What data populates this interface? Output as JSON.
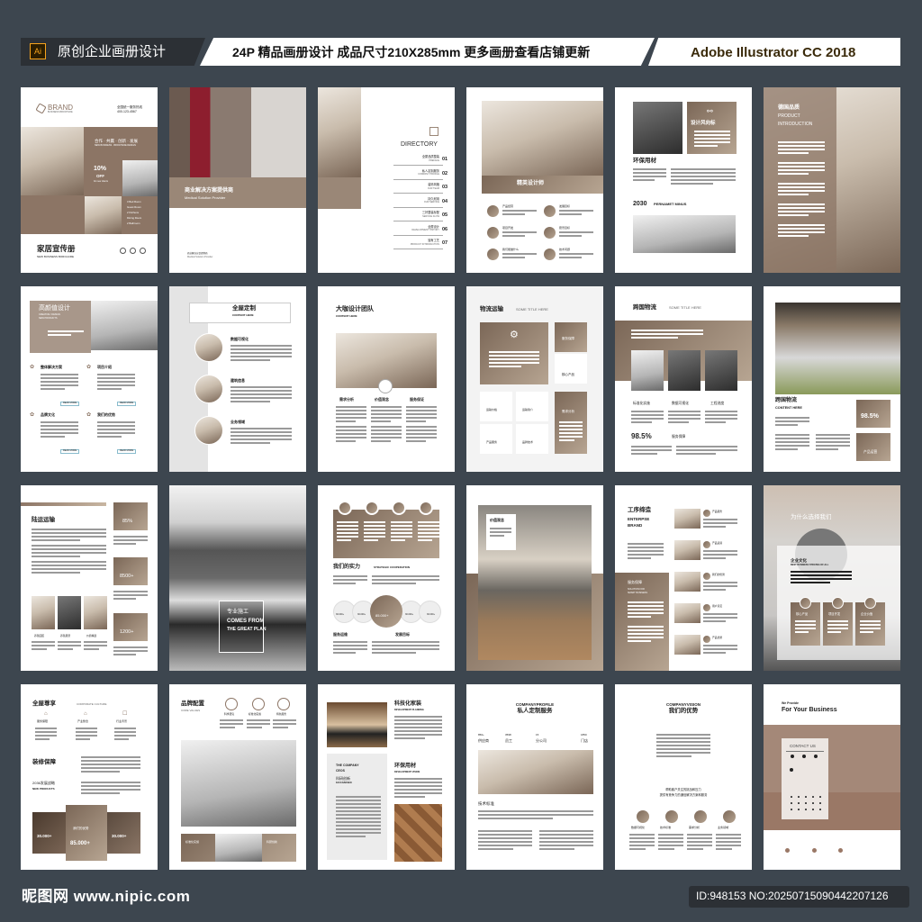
{
  "header": {
    "ai_badge": "Ai",
    "left_title": "原创企业画册设计",
    "center_text": "24P 精品画册设计 成品尺寸210X285mm 更多画册查看店铺更新",
    "right_text": "Adobe Illustrator CC 2018"
  },
  "footer": {
    "logo_text": "昵图网 www.nipic.com",
    "id_text": "ID:948153 NO:20250715090442207126"
  },
  "colors": {
    "background": "#3d464f",
    "accent_brown": "#8c7565",
    "tan_light": "#b7a592"
  },
  "pages": {
    "p1": {
      "brand": "BRAND",
      "brand_sub": "BUSINESS BROCHURE",
      "hotline": "全国统一服务热线",
      "phone": "400-123-4567",
      "slogan": "合作 · 共赢 · 创新 · 发展",
      "slogan_en": "NEW BUSINESS · BROCHURE DESIGN",
      "discount": "10%",
      "off": "OFF",
      "discount_note": "for new clients",
      "rooms": [
        "3 Bed Room",
        "Guest Room",
        "2 Kitchens",
        "Dining Room",
        "2 Bathroom"
      ],
      "title": "家居宣传册",
      "subtitle": "NEW BUSINESS BORCHURE"
    },
    "p2": {
      "title": "商业解决方案提供商",
      "subtitle": "Medical Solution Provider"
    },
    "p3": {
      "title": "DIRECTORY",
      "entries": [
        {
          "cn": "全屋品质整装",
          "en": "PREFACE",
          "num": "01"
        },
        {
          "cn": "私人定制服务",
          "en": "COMPANY PROFILE",
          "num": "02"
        },
        {
          "cn": "装饰风格",
          "en": "OUR TEAM",
          "num": "03"
        },
        {
          "cn": "持久耐用",
          "en": "OUR SERVICE",
          "num": "04"
        },
        {
          "cn": "三好整装标配",
          "en": "SERVICE FLOW",
          "num": "05"
        },
        {
          "cn": "全屋设计",
          "en": "DEVELOPMENT HISTORY",
          "num": "06"
        },
        {
          "cn": "独有工艺",
          "en": "PRODUCT INTRODUCTION",
          "num": "07"
        }
      ]
    },
    "p4": {
      "banner": "精英设计师",
      "items": [
        "产品经营",
        "发展目标",
        "项目开发",
        "愿景目标",
        "我们能做什么",
        "技术问题"
      ]
    },
    "p5": {
      "box_title": "设计风向标",
      "heading": "环保用材",
      "year_title": "2030",
      "year_sub": "PERNAMET MINUS"
    },
    "p6": {
      "title": "德国品质",
      "subtitle_1": "PRODUCT",
      "subtitle_2": "INTRODUCTION"
    },
    "p7": {
      "title": "高颜值设计",
      "sub1": "CREATIVE / DESIGN",
      "sub2": "NEW PRODUCTS",
      "items": [
        "整体解决方案",
        "项目介绍",
        "品牌文化",
        "我们的优势"
      ],
      "read_more": "READ MORE"
    },
    "p8": {
      "title": "全屋定制",
      "subtitle": "CONTENT HERE",
      "items": [
        "数据可视化",
        "建筑信息",
        "业务领域"
      ]
    },
    "p9": {
      "title": "大咖设计团队",
      "subtitle": "CONTENT HERE",
      "cols": [
        "需求分析",
        "价值观念",
        "服务保证"
      ]
    },
    "p10": {
      "title": "物流运输",
      "subtitle": "SOME TITLE HERE",
      "labels": [
        "服务保障",
        "核心产品",
        "需求分析",
        "运输价格",
        "运输简介",
        "产品服务",
        "品牌技术"
      ]
    },
    "p11": {
      "title": "跨国物流",
      "subtitle": "SOME TITLE HERE",
      "labels": [
        "标准化实施",
        "数据可视化",
        "工程进度"
      ],
      "stat": "98.5%",
      "stat_label": "服务保障"
    },
    "p12": {
      "title": "跨国物流",
      "subtitle": "CONTENT HERE",
      "stat": "98.5%",
      "box_label": "产品运营"
    },
    "p13": {
      "title": "陆运运输",
      "stats": [
        "85%",
        "8500+",
        "1200+"
      ],
      "photo_labels": [
        "养殖园区",
        "养殖展望",
        "价值精选"
      ]
    },
    "p14": {
      "line1": "专业施工",
      "line2": "COMES FROM",
      "line3": "THE GREAT PLAN"
    },
    "p15": {
      "title": "我们的实力",
      "subtitle": "STRATEGIC COOPERATION",
      "small_stats": [
        "30.000+",
        "30.000+",
        "30.000+",
        "30.000+"
      ],
      "big_stat": "85.000+",
      "sec1": "服务运维",
      "sec2": "发展目标"
    },
    "p16": {
      "box_title": "价值观念"
    },
    "p17": {
      "title": "工序缔造",
      "sub1": "ENTERPSE",
      "sub2": "BRAND",
      "panel_title": "服务保障",
      "panel_sub1": "SOLUTION FOR",
      "panel_sub2": "SMART BUSINESS",
      "items": [
        "产品服务",
        "产品运营",
        "我们的优势",
        "用户意见",
        "产品优势"
      ]
    },
    "p18": {
      "title": "为什么选择我们",
      "panel_title": "企业文化",
      "panel_sub": "BEST BUSINESS STRATEG OF ALL",
      "cards": [
        "核心产品",
        "项目开发",
        "企业价值"
      ]
    },
    "p19": {
      "title": "全屋尊享",
      "subtitle": "CORPORATE CULTURE",
      "icons": [
        "服务保障",
        "产业整合",
        "行业背景"
      ],
      "sec_title": "装修保障",
      "strategy": "2036发展战略",
      "strategy_sub": "NEW PRODUCTS",
      "stat_left": "30.000+",
      "mid_label": "我们的优势",
      "stat_mid": "85.000+",
      "stat_right": "30.000+"
    },
    "p20": {
      "title": "品牌配置",
      "subtitle": "CORE VALUES",
      "icons": [
        "科学研究",
        "标准化实施",
        "特色服务"
      ],
      "band_left": "标准化实施",
      "band_right": "科研创新"
    },
    "p21": {
      "title1": "科技化家装",
      "sub1": "DEVELOPMENT PLANNING",
      "box_en1": "THE COMPANY",
      "box_en2": "CEOS",
      "box_cn": "科研创新",
      "box_sub": "FACCABOSEN",
      "title2": "环保用材",
      "sub2": "DEVELOPMENT VISION"
    },
    "p22": {
      "en": "COMPANYPROFILE",
      "cn": "私人定制服务",
      "stats": [
        {
          "v": "850+",
          "l": "供应商"
        },
        {
          "v": "3598",
          "l": "员工"
        },
        {
          "v": "15",
          "l": "分公司"
        },
        {
          "v": "1850",
          "l": "门店"
        }
      ],
      "sec": "技术标准"
    },
    "p23": {
      "en": "COMPANYVISION",
      "cn": "我们的优势",
      "desc1": "帮助客户关注的挑战和压力",
      "desc2": "提供有竞争力的通信解决方案和服务",
      "labels": [
        "数据可视化",
        "技术标准",
        "需求分析",
        "业务领域"
      ]
    },
    "p24": {
      "pre": "We Provide",
      "title": "For Your Business",
      "card_title": "CONTACT US"
    }
  }
}
